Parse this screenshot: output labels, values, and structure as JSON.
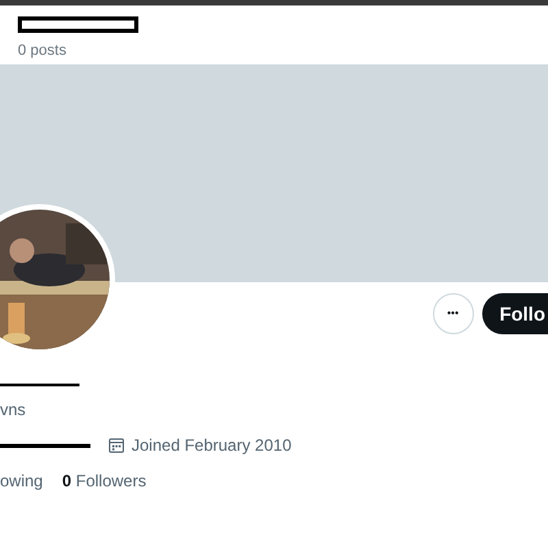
{
  "header": {
    "post_count": "0 posts"
  },
  "actions": {
    "more": "•••",
    "follow": "Follo"
  },
  "bio": "vns",
  "meta": {
    "joined": "Joined February 2010"
  },
  "stats": [
    {
      "label": "owing"
    },
    {
      "label": "**0** Followers"
    }
  ]
}
